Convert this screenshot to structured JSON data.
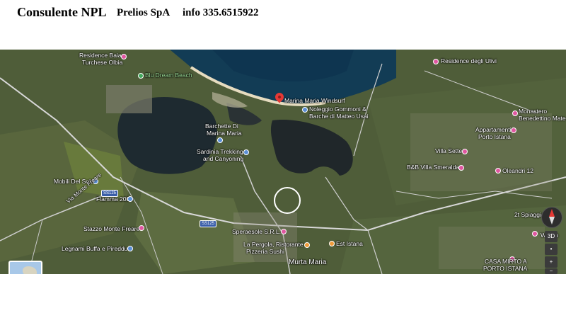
{
  "header": {
    "title": "Consulente NPL",
    "company": "Prelios SpA",
    "contact": "info 335.6515922"
  },
  "map": {
    "labels": {
      "residence_baia": "Residence Baia",
      "turchese_olbia": "Turchese Olbia",
      "blu_dream_beach": "Blu Dream Beach",
      "marina_maria_windsurf": "Marina Maria Windsurf",
      "noleggio_gommoni": "Noleggio Gommoni &",
      "barche_di_matteo": "Barche di Matteo Usai",
      "barchette_di": "Barchette Di",
      "marina_maria": "Marina Maria",
      "sardinia_trekking": "Sardinia Trekking",
      "and_canyoning": "and Canyoning",
      "residence_degli_ulivi": "Residence degli Ulivi",
      "monastero": "Monastero",
      "benedettino_mate": "Benedettino Mate",
      "appartamenti": "Appartamenti",
      "porto_istana": "Porto Istana",
      "villa_sette": "Villa Sette",
      "bb_villa_smeralda": "B&B Villa Smeralda",
      "oleandri_12": "Oleandri 12",
      "mobili_del_solo": "Mobili Del Solo",
      "flamma_2000": "Flamma 2000",
      "stazzo_monte_freare": "Stazzo Monte Freare",
      "legnami_buffa": "Legnami Buffa e Pireddu",
      "speraesole": "Speraesole S.R.L.",
      "la_pergola": "La Pergola, Ristorante",
      "pizzeria_sushi": "Pizzeria Sushi",
      "est_istana": "Est Istana",
      "murta_maria": "Murta Maria",
      "spiaggia": "2t Spiaggia",
      "w_san": "W San",
      "casa_mirto": "CASA MIRTO A",
      "porto_istana_caps": "PORTO ISTANA",
      "road_ss125_a": "SS125",
      "road_ss125_b": "SS125",
      "via_monte_freare": "Via Monte Freare"
    },
    "controls": {
      "view_3d": "3D",
      "zoom_in": "+",
      "zoom_out": "−",
      "dot_btn": "•"
    },
    "colors": {
      "sea": "#123c55",
      "lagoon": "#1e2a30",
      "land": "#4c5a36",
      "road": "#d8d8d8",
      "pin": "#e53935"
    },
    "icons": [
      "map-pin-icon",
      "poi-dot-icon",
      "compass-icon",
      "minimap-thumbnail"
    ]
  }
}
